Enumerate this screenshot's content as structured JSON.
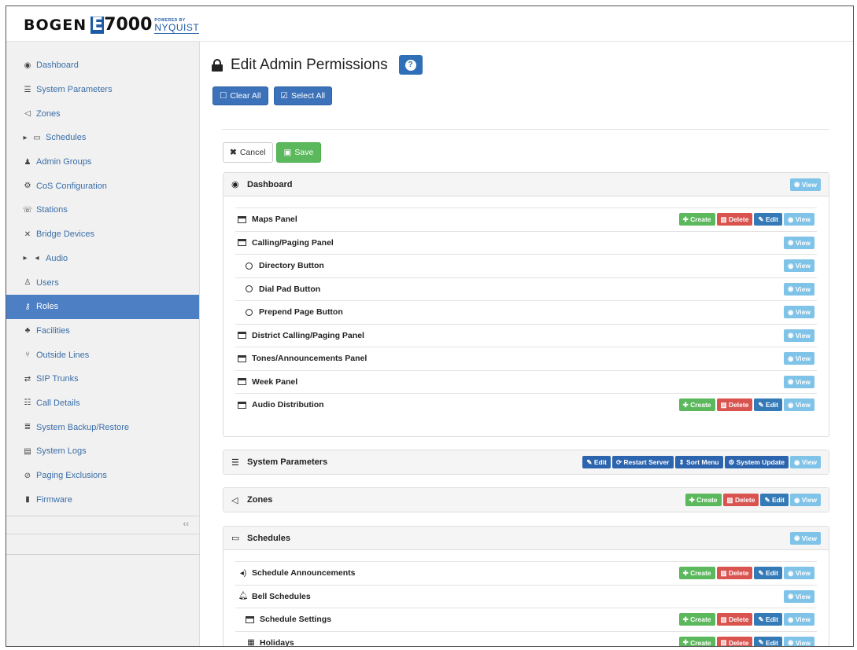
{
  "header": {
    "brand": "BOGEN",
    "product_letter": "E",
    "product_number": "7000",
    "powered_by": "POWERED BY",
    "partner": "NYQUIST"
  },
  "sidebar": {
    "items": [
      {
        "label": "Dashboard",
        "icon": "dashboard-icon"
      },
      {
        "label": "System Parameters",
        "icon": "list-icon"
      },
      {
        "label": "Zones",
        "icon": "bullhorn-icon"
      },
      {
        "label": "Schedules",
        "icon": "calendar-icon"
      },
      {
        "label": "Admin Groups",
        "icon": "group-icon"
      },
      {
        "label": "CoS Configuration",
        "icon": "cogs-icon"
      },
      {
        "label": "Stations",
        "icon": "phone-icon"
      },
      {
        "label": "Bridge Devices",
        "icon": "bridge-icon"
      },
      {
        "label": "Audio",
        "icon": "volume-icon"
      },
      {
        "label": "Users",
        "icon": "user-icon"
      },
      {
        "label": "Roles",
        "icon": "key-icon"
      },
      {
        "label": "Facilities",
        "icon": "facilities-icon"
      },
      {
        "label": "Outside Lines",
        "icon": "outside-lines-icon"
      },
      {
        "label": "SIP Trunks",
        "icon": "exchange-icon"
      },
      {
        "label": "Call Details",
        "icon": "table-list-icon"
      },
      {
        "label": "System Backup/Restore",
        "icon": "database-icon"
      },
      {
        "label": "System Logs",
        "icon": "file-icon"
      },
      {
        "label": "Paging Exclusions",
        "icon": "ban-icon"
      },
      {
        "label": "Firmware",
        "icon": "book-icon"
      }
    ],
    "active": "Roles",
    "collapse_label": "‹‹"
  },
  "page": {
    "title": "Edit Admin Permissions",
    "help_label": "?",
    "clear_all": "Clear All",
    "select_all": "Select All",
    "cancel": "Cancel",
    "save": "Save"
  },
  "buttons": {
    "create": "Create",
    "delete": "Delete",
    "edit": "Edit",
    "view": "View",
    "restart_server": "Restart Server",
    "sort_menu": "Sort Menu",
    "system_update": "System Update"
  },
  "panels": {
    "dashboard": {
      "title": "Dashboard",
      "rows": [
        {
          "label": "Maps Panel"
        },
        {
          "label": "Calling/Paging Panel"
        },
        {
          "label": "Directory Button"
        },
        {
          "label": "Dial Pad Button"
        },
        {
          "label": "Prepend Page Button"
        },
        {
          "label": "District Calling/Paging Panel"
        },
        {
          "label": "Tones/Announcements Panel"
        },
        {
          "label": "Week Panel"
        },
        {
          "label": "Audio Distribution"
        }
      ]
    },
    "system_parameters": {
      "title": "System Parameters"
    },
    "zones": {
      "title": "Zones"
    },
    "schedules": {
      "title": "Schedules",
      "rows": [
        {
          "label": "Schedule Announcements"
        },
        {
          "label": "Bell Schedules"
        },
        {
          "label": "Schedule Settings"
        },
        {
          "label": "Holidays"
        }
      ]
    }
  },
  "colors": {
    "primary": "#3b72b9",
    "success": "#5cb85c",
    "danger": "#d9534f",
    "info": "#7fc3e8",
    "active_nav": "#4d7fc4"
  }
}
